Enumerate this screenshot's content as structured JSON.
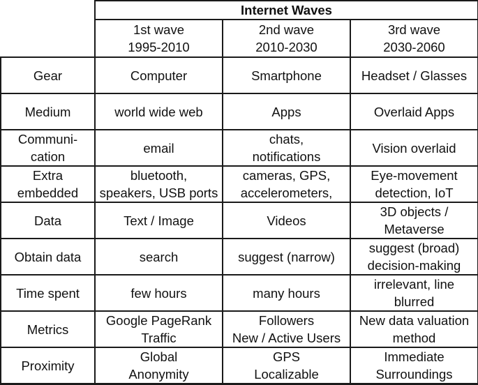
{
  "table": {
    "title": "Internet Waves",
    "waves": [
      {
        "name": "1st wave",
        "years": "1995-2010"
      },
      {
        "name": "2nd wave",
        "years": "2010-2030"
      },
      {
        "name": "3rd wave",
        "years": "2030-2060"
      }
    ],
    "rows": [
      {
        "label": [
          "Gear"
        ],
        "cells": [
          [
            "Computer"
          ],
          [
            "Smartphone"
          ],
          [
            "Headset / Glasses"
          ]
        ]
      },
      {
        "label": [
          "Medium"
        ],
        "cells": [
          [
            "world wide web"
          ],
          [
            "Apps"
          ],
          [
            "Overlaid Apps"
          ]
        ]
      },
      {
        "label": [
          "Communi-",
          "cation"
        ],
        "cells": [
          [
            "email"
          ],
          [
            "chats,",
            "notifications"
          ],
          [
            "Vision overlaid"
          ]
        ]
      },
      {
        "label": [
          "Extra",
          "embedded"
        ],
        "cells": [
          [
            "bluetooth,",
            "speakers, USB ports"
          ],
          [
            "cameras, GPS,",
            "accelerometers,"
          ],
          [
            "Eye-movement",
            "detection, IoT"
          ]
        ]
      },
      {
        "label": [
          "Data"
        ],
        "cells": [
          [
            "Text / Image"
          ],
          [
            "Videos"
          ],
          [
            "3D objects /",
            "Metaverse"
          ]
        ]
      },
      {
        "label": [
          "Obtain data"
        ],
        "cells": [
          [
            "search"
          ],
          [
            "suggest (narrow)"
          ],
          [
            "suggest (broad)",
            "decision-making"
          ]
        ]
      },
      {
        "label": [
          "Time spent"
        ],
        "cells": [
          [
            "few hours"
          ],
          [
            "many hours"
          ],
          [
            "irrelevant, line",
            "blurred"
          ]
        ]
      },
      {
        "label": [
          "Metrics"
        ],
        "cells": [
          [
            "Google PageRank",
            "Traffic"
          ],
          [
            "Followers",
            "New / Active Users"
          ],
          [
            "New data valuation",
            "method"
          ]
        ]
      },
      {
        "label": [
          "Proximity"
        ],
        "cells": [
          [
            "Global",
            "Anonymity"
          ],
          [
            "GPS",
            "Localizable"
          ],
          [
            "Immediate",
            "Surroundings"
          ]
        ]
      }
    ]
  }
}
